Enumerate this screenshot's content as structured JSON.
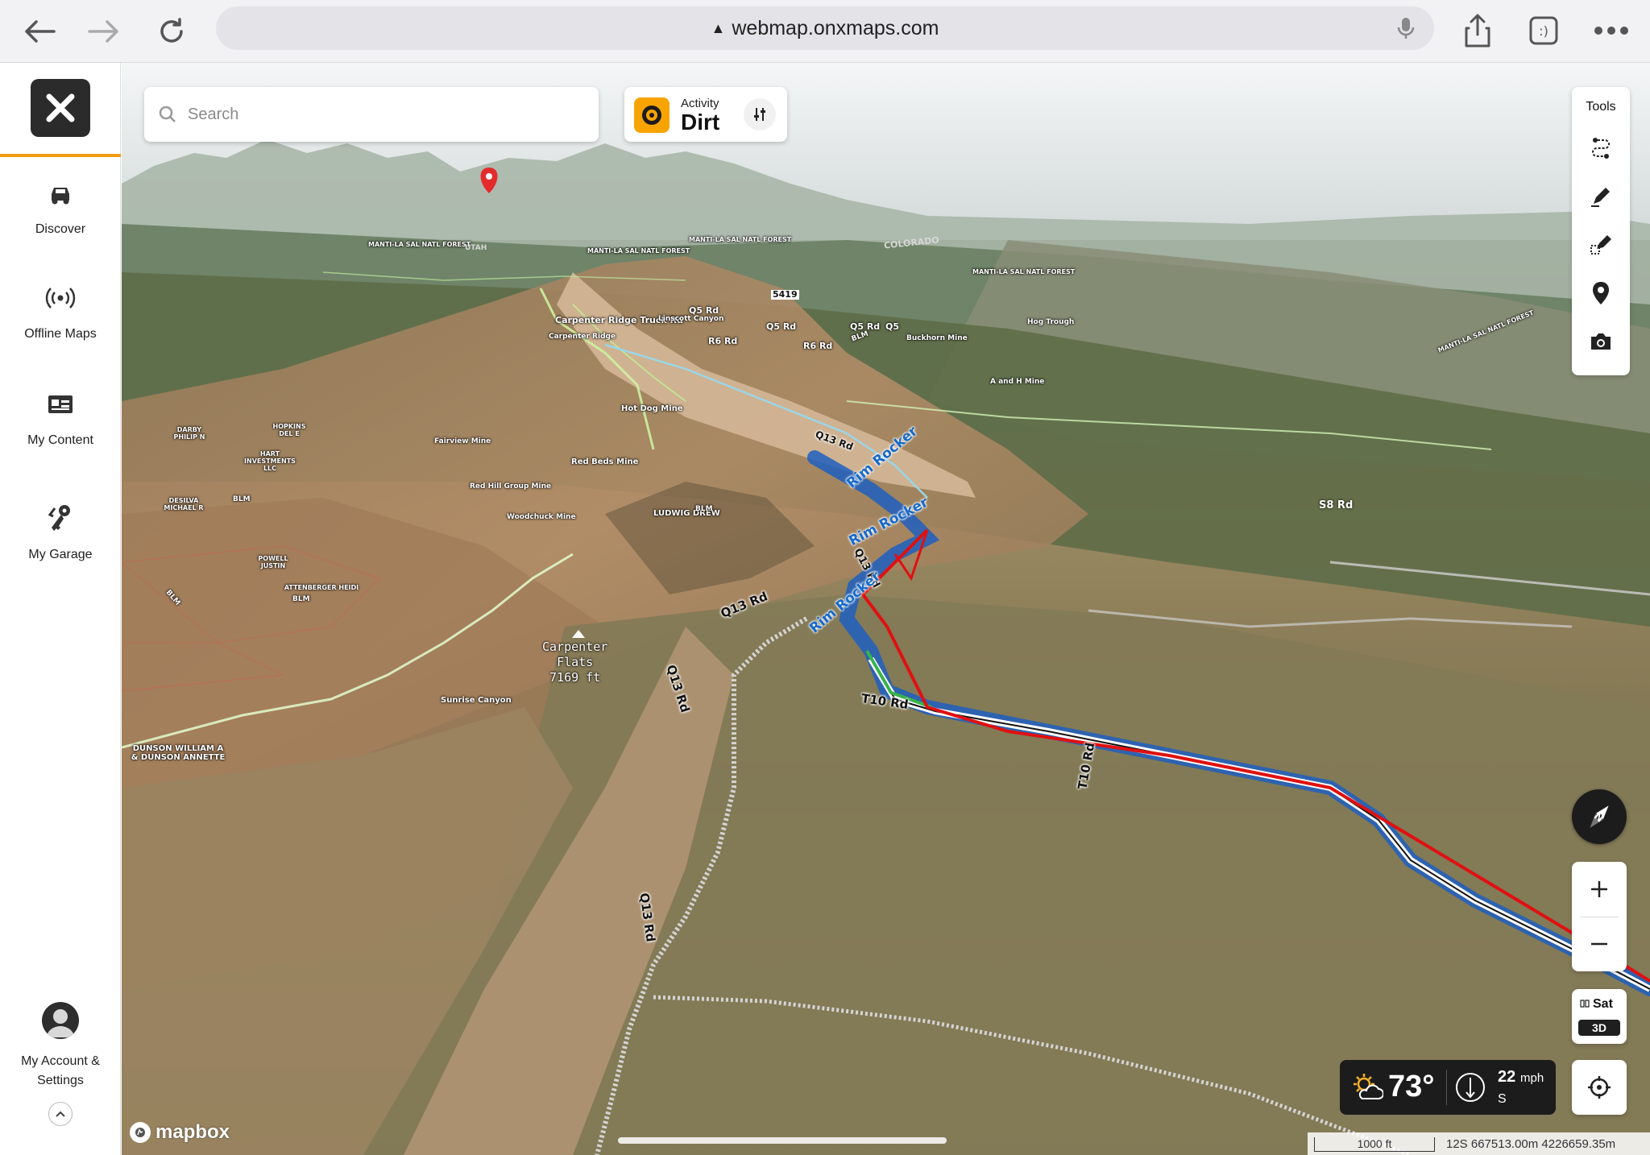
{
  "browser": {
    "url": "webmap.onxmaps.com"
  },
  "sidebar": {
    "items": [
      {
        "label": "Discover",
        "icon": "offroad-vehicle-icon"
      },
      {
        "label": "Offline Maps",
        "icon": "broadcast-icon"
      },
      {
        "label": "My Content",
        "icon": "content-card-icon"
      },
      {
        "label": "My Garage",
        "icon": "keys-icon"
      }
    ],
    "account_label": "My Account & Settings"
  },
  "search": {
    "placeholder": "Search"
  },
  "activity": {
    "label": "Activity",
    "value": "Dirt"
  },
  "tools": {
    "title": "Tools",
    "items": [
      "route-icon",
      "pencil-icon",
      "draw-area-icon",
      "pin-icon",
      "camera-icon"
    ]
  },
  "layers": {
    "base": "Sat",
    "mode": "3D"
  },
  "weather": {
    "temperature": "73°",
    "wind_speed": "22",
    "wind_unit": "mph",
    "wind_direction": "S"
  },
  "scale": {
    "distance": "1000 ft",
    "coordinates": "12S 667513.00m 4226659.35m"
  },
  "attribution": "mapbox",
  "map_labels": {
    "peak": [
      "Carpenter",
      "Flats",
      "7169 ft"
    ],
    "roads": [
      "Q13 Rd",
      "Q13 Rd",
      "Q13 Rd",
      "Q13 Rd",
      "Q13 Rd",
      "T10 Rd",
      "T10 Rd",
      "S8 Rd",
      "Q5 Rd",
      "Q5 Rd",
      "Q5 Rd",
      "R6 Rd",
      "R6 Rd",
      "Q5",
      "5419",
      "Carpenter Ridge Truck Rd"
    ],
    "trails": [
      "Rim Rocker",
      "Rim Rocker",
      "Rim Rocker"
    ],
    "places": [
      "MANTI-LA SAL NATL FOREST",
      "MANTI-LA SAL NATL FOREST",
      "MANTI-LA SAL NATL FOREST",
      "MANTI-LA SAL NATL FOREST",
      "COLORADO",
      "UTAH",
      "Linscott Canyon",
      "Carpenter Ridge",
      "Hot Dog Mine",
      "Red Beds Mine",
      "Fairview Mine",
      "Red Hill Group Mine",
      "Woodchuck Mine",
      "LUDWIG DREW",
      "BLM",
      "BLM",
      "BLM",
      "BLM",
      "BLM",
      "Buckhorn Mine",
      "Hog Trough",
      "A and H Mine",
      "MANTI-LA SAL NATL FOREST",
      "Sunrise Canyon",
      "DUNSON WILLIAM A & DUNSON ANNETTE",
      "DARBY PHILIP N",
      "HOPKINS DEL E",
      "HART INVESTMENTS LLC",
      "DESILVA MICHAEL R",
      "POWELL JUSTIN",
      "ATTENBERGER HEIDI"
    ]
  },
  "colors": {
    "accent": "#f39c12",
    "trail_blue": "#1769c9",
    "boundary_red": "#e01010"
  }
}
